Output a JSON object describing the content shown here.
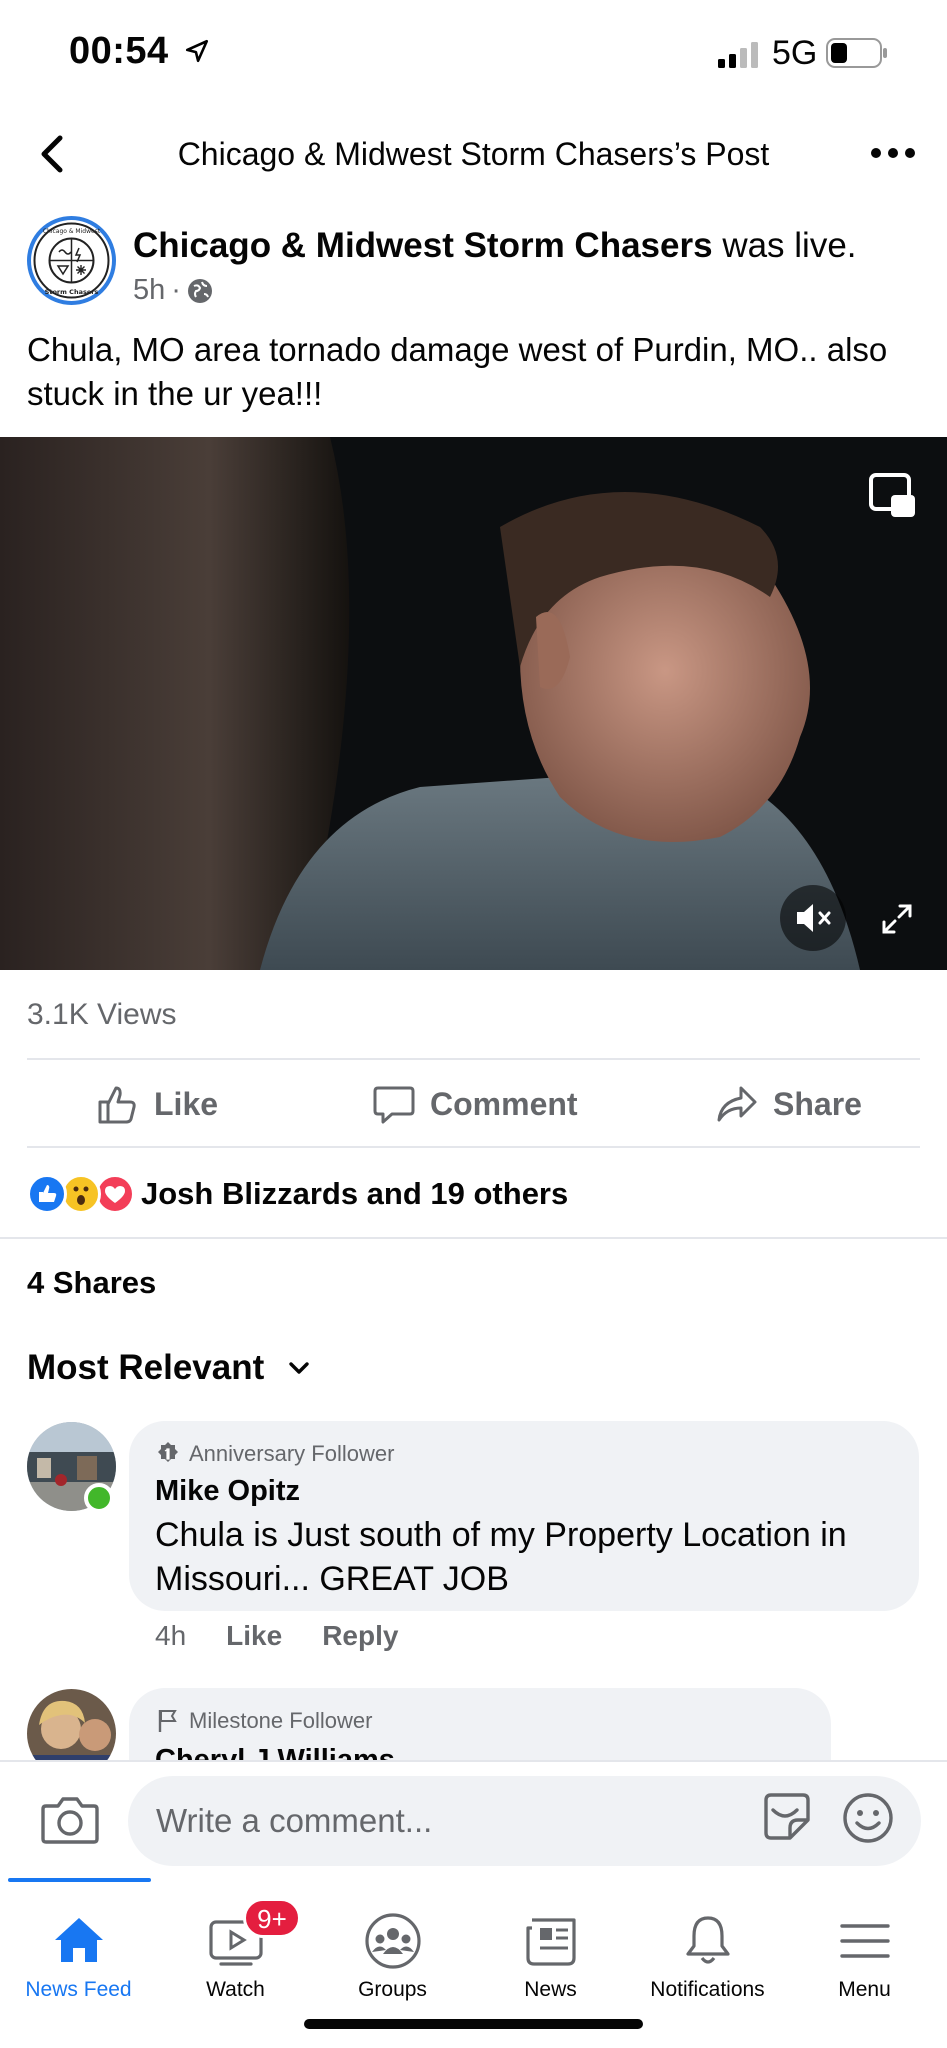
{
  "status_bar": {
    "time": "00:54",
    "network": "5G"
  },
  "header": {
    "title": "Chicago & Midwest Storm Chasers’s Post"
  },
  "post": {
    "author": "Chicago & Midwest Storm Chasers",
    "author_suffix": "was live.",
    "time": "5h",
    "separator": "·",
    "avatar_text_top": "Chicago & Midwest",
    "avatar_text_bottom": "Storm Chasers",
    "text": "Chula, MO area tornado damage west of Purdin, MO.. also stuck in the ur yea!!!",
    "views": "3.1K Views"
  },
  "actions": {
    "like": "Like",
    "comment": "Comment",
    "share": "Share"
  },
  "reactions": {
    "text": "Josh Blizzards and 19 others",
    "types": [
      "like-icon",
      "wow-icon",
      "love-icon"
    ]
  },
  "shares": "4 Shares",
  "sort_label": "Most Relevant",
  "comments": [
    {
      "badge": "Anniversary Follower",
      "name": "Mike Opitz",
      "text": "Chula is Just south of my Property Location in Missouri... GREAT JOB",
      "time": "4h",
      "like": "Like",
      "reply": "Reply"
    },
    {
      "badge": "Milestone Follower",
      "name": "Cheryl J Williams"
    }
  ],
  "composer": {
    "placeholder": "Write a comment..."
  },
  "tabs": [
    {
      "label": "News Feed",
      "icon": "home-icon"
    },
    {
      "label": "Watch",
      "icon": "watch-icon",
      "badge": "9+"
    },
    {
      "label": "Groups",
      "icon": "groups-icon"
    },
    {
      "label": "News",
      "icon": "news-icon"
    },
    {
      "label": "Notifications",
      "icon": "bell-icon"
    },
    {
      "label": "Menu",
      "icon": "menu-icon"
    }
  ],
  "colors": {
    "accent": "#1877f2",
    "secondary_text": "#65676b",
    "bubble": "#f0f2f5",
    "badge_red": "#e41e3f",
    "online": "#42b72a"
  }
}
